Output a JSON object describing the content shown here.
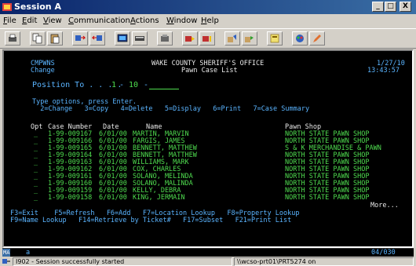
{
  "window": {
    "title": "Session A",
    "btn_min": "_",
    "btn_max": "□",
    "btn_close": "X"
  },
  "menu": [
    "File",
    "Edit",
    "View",
    "Communication",
    "Actions",
    "Window",
    "Help"
  ],
  "toolbar": [
    "print-icon",
    "copy-icon",
    "paste-icon",
    "send-icon",
    "receive-icon",
    "display-icon",
    "keyboard-icon",
    "record-icon",
    "play-icon",
    "pause-icon",
    "macro-icon",
    "macro-run-icon",
    "map-icon",
    "color-palette-icon",
    "edit-icon"
  ],
  "screen": {
    "program": "CMPWNS",
    "mode": "Change",
    "org": "WAKE COUNTY SHERIFF'S OFFICE",
    "title": "Pawn Case List",
    "date": "1/27/10",
    "time": "13:43:57",
    "position_label": "Position To . . . .",
    "position_value1": "1",
    "position_sep": "-",
    "position_value2": "10",
    "position_sep2": "-",
    "options_header": "Type options, press Enter.",
    "options_line": "  2=Change   3=Copy   4=Delete   5=Display   6=Print   7=Case Summary",
    "col_opt": "Opt",
    "col_case": "Case Number",
    "col_date": "Date",
    "col_name": "Name",
    "col_shop": "Pawn Shop",
    "rows": [
      {
        "opt": "_",
        "case": "1-99-009167",
        "date": "6/01/00",
        "name": "MARTIN, MARVIN",
        "shop": "NORTH STATE PAWN SHOP"
      },
      {
        "opt": "_",
        "case": "1-99-009166",
        "date": "6/01/00",
        "name": "FARGIS, JAMES",
        "shop": "NORTH STATE PAWN SHOP"
      },
      {
        "opt": "_",
        "case": "1-99-009165",
        "date": "6/01/00",
        "name": "BENNETT, MATTHEW",
        "shop": "S & K MERCHANDISE & PAWN"
      },
      {
        "opt": "_",
        "case": "1-99-009164",
        "date": "6/01/00",
        "name": "BENNETT, MATTHEW",
        "shop": "NORTH STATE PAWN SHOP"
      },
      {
        "opt": "_",
        "case": "1-99-009163",
        "date": "6/01/00",
        "name": "WILLIAMS, MARK",
        "shop": "NORTH STATE PAWN SHOP"
      },
      {
        "opt": "_",
        "case": "1-99-009162",
        "date": "6/01/00",
        "name": "COX, CHARLES",
        "shop": "NORTH STATE PAWN SHOP"
      },
      {
        "opt": "_",
        "case": "1-99-009161",
        "date": "6/01/00",
        "name": "SOLANO, MELINDA",
        "shop": "NORTH STATE PAWN SHOP"
      },
      {
        "opt": "_",
        "case": "1-99-009160",
        "date": "6/01/00",
        "name": "SOLANO, MALINDA",
        "shop": "NORTH STATE PAWN SHOP"
      },
      {
        "opt": "_",
        "case": "1-99-009159",
        "date": "6/01/00",
        "name": "KELLY, DEBRA",
        "shop": "NORTH STATE PAWN SHOP"
      },
      {
        "opt": "_",
        "case": "1-99-009158",
        "date": "6/01/00",
        "name": "KING, JERMAIN",
        "shop": "NORTH STATE PAWN SHOP"
      }
    ],
    "more": "More...",
    "fkeys1": "F3=Exit    F5=Refresh   F6=Add   F7=Location Lookup   F8=Property Lookup",
    "fkeys2": "F9=Name Lookup   F14=Retrieve by Ticket#   F17=Subset   F21=Print List"
  },
  "oia": {
    "indicator": "MA",
    "session": "a",
    "cursor": "04/030"
  },
  "status": {
    "message": "I902 - Session successfully started",
    "printer": "\\\\wcso-prt01\\PRT5274 on"
  }
}
